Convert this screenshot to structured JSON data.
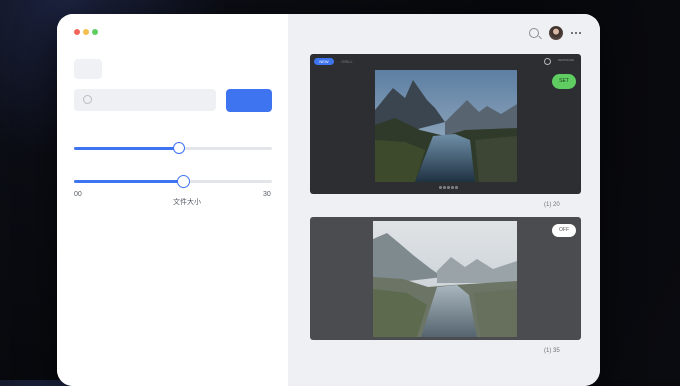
{
  "window": {
    "traffic_lights": [
      "close",
      "minimize",
      "zoom"
    ]
  },
  "left_panel": {
    "search": {
      "placeholder": "",
      "icon": "search-icon"
    },
    "primary_button": {
      "label": "",
      "color": "#3f74f0"
    },
    "slider1": {
      "value_fraction": 0.53
    },
    "slider2": {
      "value_fraction": 0.55,
      "min_label": "00",
      "max_label": "30",
      "caption": "文件大小"
    }
  },
  "right_panel": {
    "toolbar": {
      "search_icon": "search-icon",
      "avatar": "user-avatar",
      "more_icon": "more-icon"
    },
    "card1": {
      "tabs": [
        "NEW",
        "GRILL"
      ],
      "link": "NEWMODE",
      "badge": "SET",
      "photo": "mountain-river-dark",
      "page_dots": 5,
      "meta": "(1)  20"
    },
    "card2": {
      "badge": "OFF",
      "photo": "mountain-river-misty",
      "meta": "(1)  35"
    }
  },
  "colors": {
    "accent": "#3f74f0",
    "green": "#5fcd62",
    "background": "#07080c"
  }
}
